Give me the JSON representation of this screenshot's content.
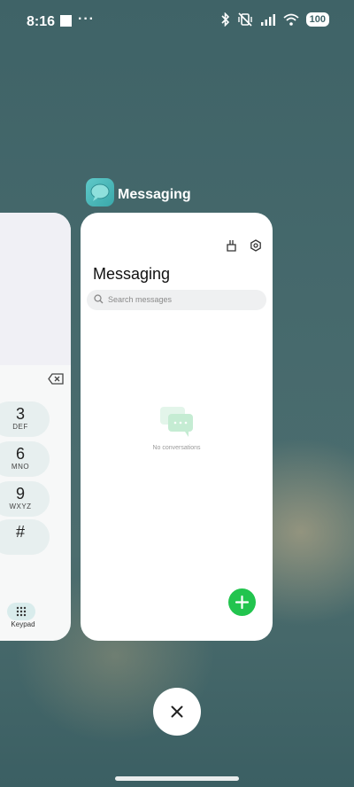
{
  "status_bar": {
    "time": "8:16",
    "overflow_dots": "···",
    "battery": "100"
  },
  "dialer_card": {
    "keys": [
      {
        "digit": "3",
        "letters": "DEF"
      },
      {
        "digit": "6",
        "letters": "MNO"
      },
      {
        "digit": "9",
        "letters": "WXYZ"
      },
      {
        "digit": "#",
        "letters": ""
      }
    ],
    "keypad_label": "Keypad"
  },
  "messaging_card": {
    "app_label": "Messaging",
    "title": "Messaging",
    "search_placeholder": "Search messages",
    "empty_text": "No conversations",
    "accent_color": "#22c44e"
  }
}
